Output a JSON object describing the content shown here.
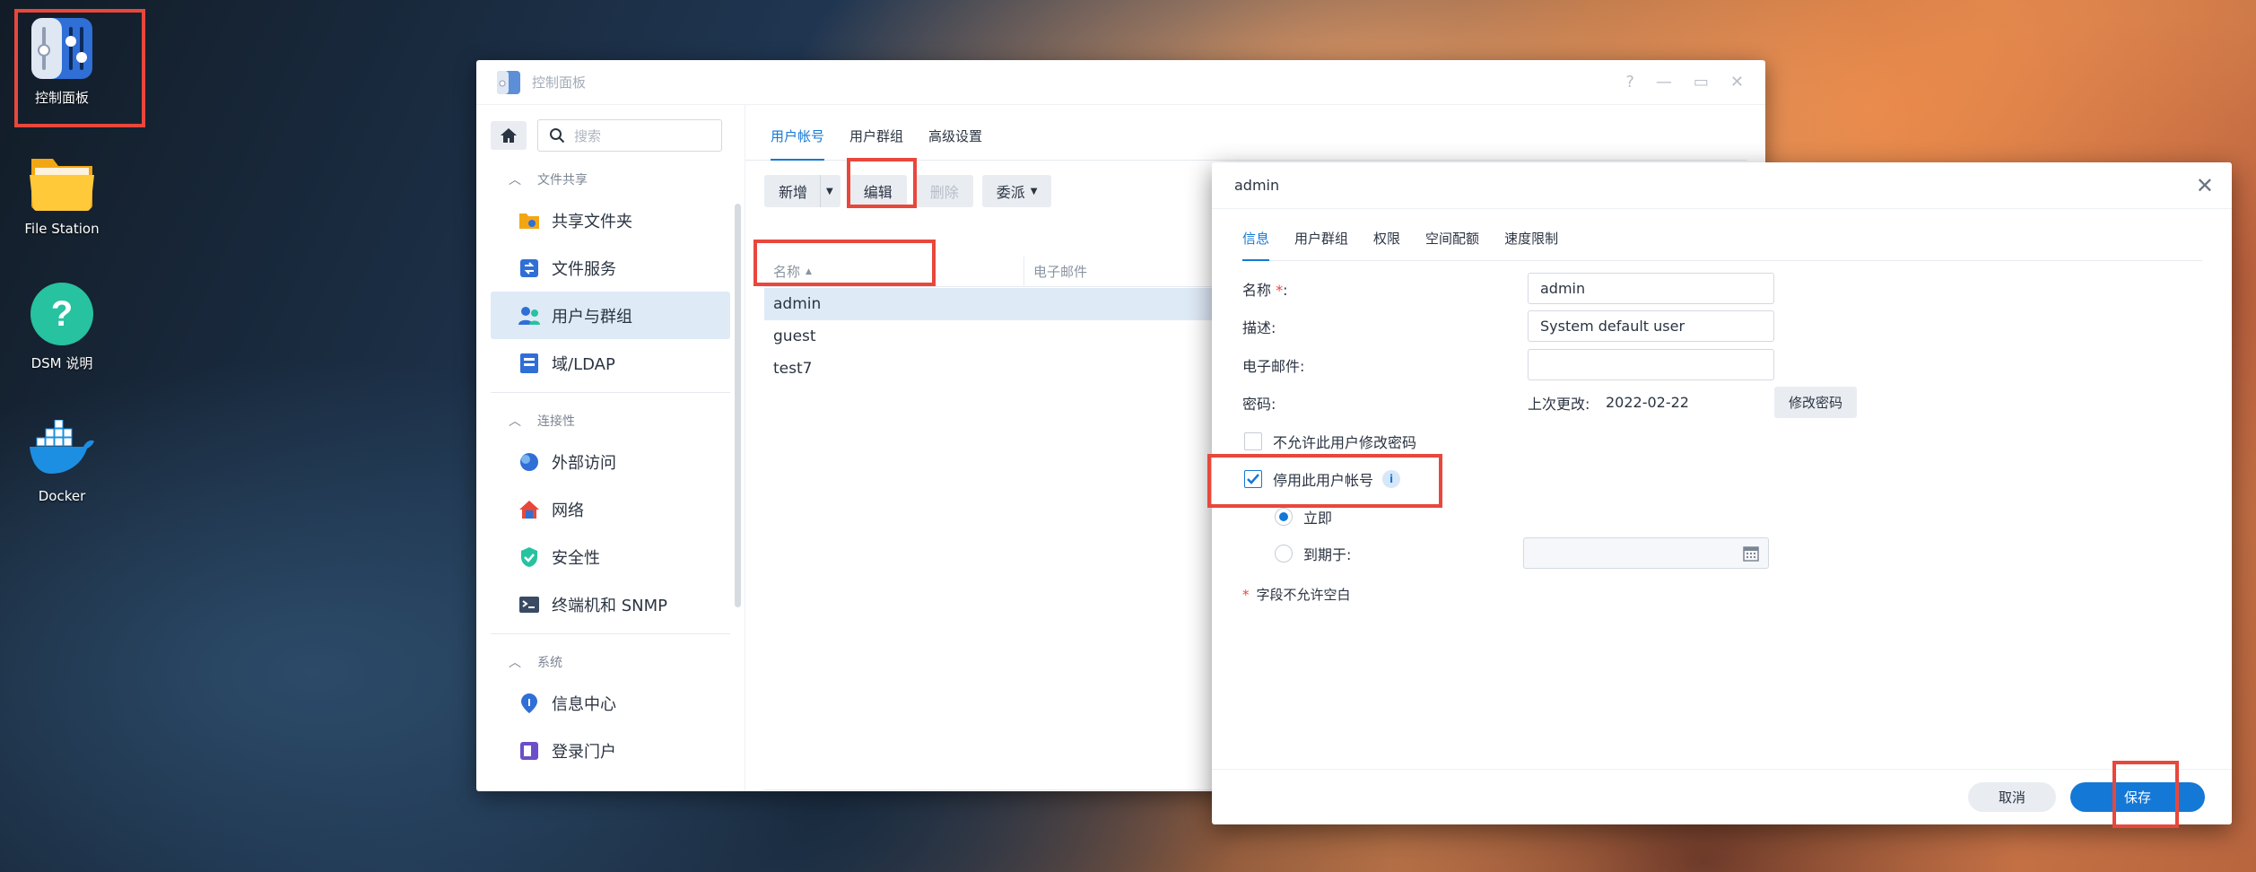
{
  "desktop": {
    "icons": [
      {
        "label": "控制面板",
        "icon": "control-panel-icon"
      },
      {
        "label": "File Station",
        "icon": "folder-icon"
      },
      {
        "label": "DSM 说明",
        "icon": "help-icon"
      },
      {
        "label": "Docker",
        "icon": "docker-icon"
      }
    ]
  },
  "control_panel": {
    "title": "控制面板",
    "window_controls": {
      "help": "?",
      "minimize": "—",
      "maximize": "▭",
      "close": "✕"
    },
    "search_placeholder": "搜索",
    "sections": [
      {
        "label": "文件共享",
        "items": [
          {
            "label": "共享文件夹",
            "icon": "shared-folder-icon"
          },
          {
            "label": "文件服务",
            "icon": "file-services-icon"
          },
          {
            "label": "用户与群组",
            "icon": "user-group-icon",
            "active": true
          },
          {
            "label": "域/LDAP",
            "icon": "ldap-icon"
          }
        ]
      },
      {
        "label": "连接性",
        "items": [
          {
            "label": "外部访问",
            "icon": "external-access-icon"
          },
          {
            "label": "网络",
            "icon": "network-icon"
          },
          {
            "label": "安全性",
            "icon": "security-icon"
          },
          {
            "label": "终端机和 SNMP",
            "icon": "terminal-icon"
          }
        ]
      },
      {
        "label": "系统",
        "items": [
          {
            "label": "信息中心",
            "icon": "info-center-icon"
          },
          {
            "label": "登录门户",
            "icon": "login-portal-icon"
          }
        ]
      }
    ],
    "tabs": [
      "用户帐号",
      "用户群组",
      "高级设置"
    ],
    "toolbar": {
      "add": "新增",
      "edit": "编辑",
      "delete": "删除",
      "assign": "委派"
    },
    "columns": {
      "name": "名称",
      "email": "电子邮件"
    },
    "users": [
      "admin",
      "guest",
      "test7"
    ]
  },
  "dialog": {
    "title": "admin",
    "tabs": [
      "信息",
      "用户群组",
      "权限",
      "空间配额",
      "速度限制"
    ],
    "name_label": "名称",
    "required_mark": "*",
    "colon": ":",
    "name_value": "admin",
    "desc_label": "描述:",
    "desc_value": "System default user",
    "email_label": "电子邮件:",
    "email_value": "",
    "password_label": "密码:",
    "last_changed_label": "上次更改:",
    "last_changed_value": "2022-02-22",
    "change_password_button": "修改密码",
    "disallow_change_label": "不允许此用户修改密码",
    "disable_account_label": "停用此用户帐号",
    "info_badge": "i",
    "immediately_label": "立即",
    "expire_label": "到期于:",
    "required_note": "字段不允许空白",
    "cancel_button": "取消",
    "save_button": "保存"
  },
  "colors": {
    "accent": "#1478d6",
    "highlight_box": "#e8473c"
  }
}
